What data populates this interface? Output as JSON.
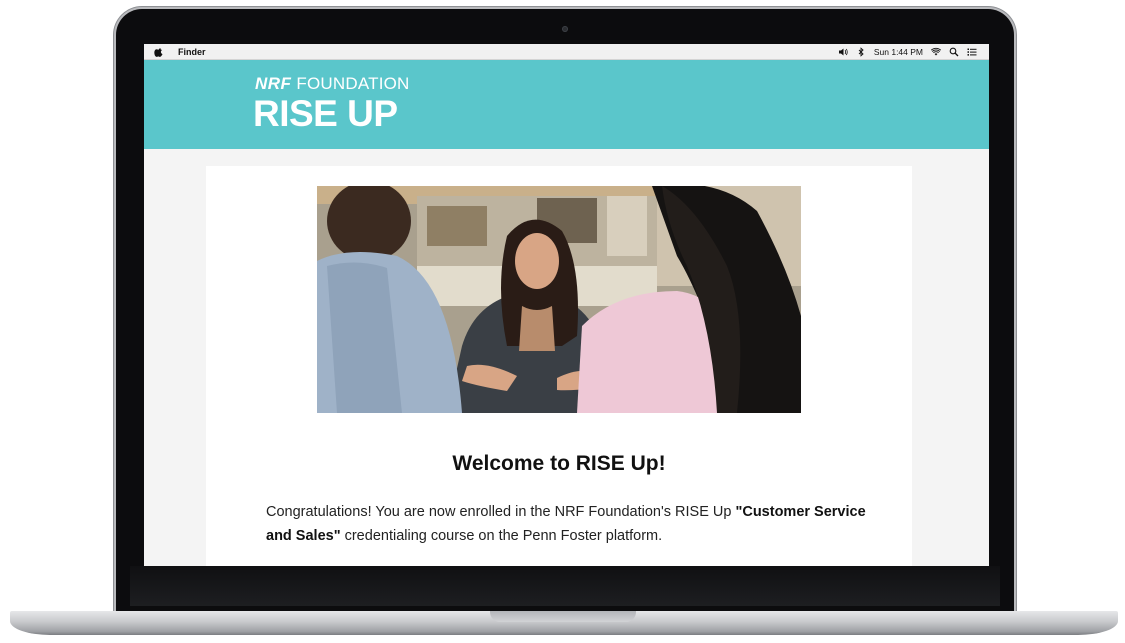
{
  "menubar": {
    "app_name": "Finder",
    "clock": "Sun 1:44 PM"
  },
  "brand": {
    "logo_prefix": "NRF",
    "logo_suffix": "FOUNDATION",
    "logo_main": "RISE UP",
    "banner_color": "#5ac6cb"
  },
  "email": {
    "heading": "Welcome to RISE Up!",
    "body_intro": "Congratulations! You are now enrolled in the NRF Foundation's RISE Up ",
    "course_name": "\"Customer Service and Sales\"",
    "body_outro": " credentialing course on the Penn Foster platform."
  },
  "icons": {
    "apple": "apple-logo-icon",
    "volume": "volume-icon",
    "bluetooth": "bluetooth-icon",
    "wifi": "wifi-icon",
    "search": "spotlight-search-icon",
    "list": "notification-center-icon"
  }
}
